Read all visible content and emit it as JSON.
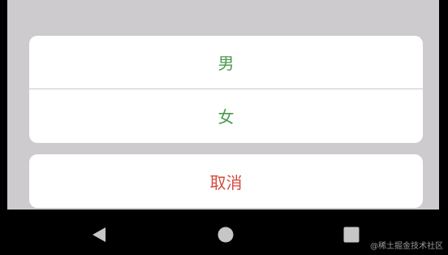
{
  "action_sheet": {
    "options": [
      {
        "label": "男"
      },
      {
        "label": "女"
      }
    ],
    "cancel_label": "取消"
  },
  "colors": {
    "option_text": "#4a9a4c",
    "cancel_text": "#d44b3e",
    "overlay": "#cdcbcd",
    "sheet_background": "#ffffff",
    "navbar_background": "#000000",
    "navbar_icons": "#c6c6c6"
  },
  "navigation_bar": {
    "icons": [
      "back-icon",
      "home-icon",
      "recent-apps-icon"
    ]
  },
  "watermark": {
    "text": "@稀土掘金技术社区"
  }
}
